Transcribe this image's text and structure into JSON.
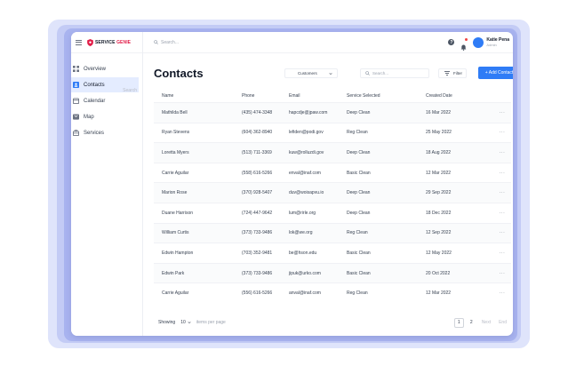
{
  "colors": {
    "accent": "#2f7cf6",
    "brand": "#e11d48",
    "active_bg": "#e4ecff"
  },
  "brand": {
    "name_part1": "SERVICE ",
    "name_part2": "GENIE"
  },
  "topbar": {
    "search_placeholder": "Search...",
    "user_name": "Katie Pena",
    "user_role": "Admin"
  },
  "sidebar": {
    "items": [
      {
        "label": "Overview",
        "icon": "grid-icon"
      },
      {
        "label": "Contacts",
        "icon": "contact-card-icon",
        "hint": "Search"
      },
      {
        "label": "Calendar",
        "icon": "calendar-icon"
      },
      {
        "label": "Map",
        "icon": "map-icon"
      },
      {
        "label": "Services",
        "icon": "briefcase-icon"
      }
    ]
  },
  "main": {
    "title": "Contacts",
    "filter_value": "Customers",
    "search_placeholder": "Search...",
    "filter_label": "Filter",
    "add_label": "+ Add Contact"
  },
  "table": {
    "columns": [
      "Name",
      "Phone",
      "Email",
      "Service Selected",
      "Created Date"
    ],
    "rows": [
      [
        "Mathilda Bell",
        "(435) 474-3348",
        "hapcdje@jpaw.com",
        "Deep Clean",
        "16 Mar 2022"
      ],
      [
        "Ryan Stevens",
        "(604) 362-8940",
        "lefiden@podi.gov",
        "Reg Clean",
        "25 May 2022"
      ],
      [
        "Loretta Myers",
        "(513) 711-3369",
        "kuw@rolluzdi.gov",
        "Deep Clean",
        "18 Aug 2022"
      ],
      [
        "Carrie Aguilar",
        "(558) 616-5266",
        "enval@inaf.com",
        "Basic Clean",
        "12 Mar 2022"
      ],
      [
        "Marion Rose",
        "(370) 928-5407",
        "duv@woisapvu.io",
        "Deep Clean",
        "29 Sep 2022"
      ],
      [
        "Duane Harrison",
        "(724) 447-9642",
        "lum@rirle.org",
        "Deep Clean",
        "18 Dec 2022"
      ],
      [
        "William Curtis",
        "(373) 733-9486",
        "lok@we.org",
        "Reg Clean",
        "12 Sep 2022"
      ],
      [
        "Edwin Hampton",
        "(703) 352-9481",
        "be@hson.edu",
        "Basic Clean",
        "12 May 2022"
      ],
      [
        "Edwin Park",
        "(373) 733-9486",
        "jipuk@urko.com",
        "Basic Clean",
        "20 Oct 2022"
      ],
      [
        "Carrie Aguilar",
        "(556) 616-5266",
        "anval@inaf.com",
        "Reg Clean",
        "12 Mar 2022"
      ]
    ],
    "row_action": "···"
  },
  "footer": {
    "showing_label": "Showing",
    "per_page_value": "10",
    "per_page_suffix": "items per page",
    "pages": [
      "1",
      "2"
    ],
    "next_label": "Next",
    "end_label": "End"
  }
}
